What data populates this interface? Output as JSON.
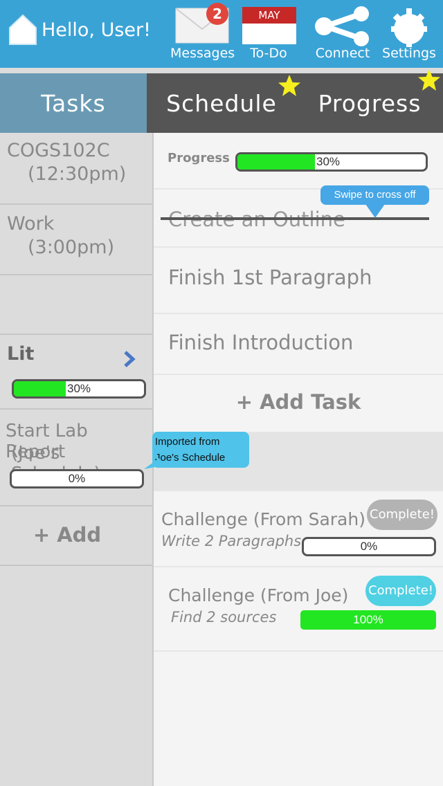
{
  "header": {
    "greeting": "Hello, User!",
    "messages": {
      "label": "Messages",
      "badge": "2"
    },
    "todo": {
      "label": "To-Do",
      "month": "MAY"
    },
    "connect": {
      "label": "Connect"
    },
    "settings": {
      "label": "Settings"
    }
  },
  "tabs": [
    {
      "label": "Tasks"
    },
    {
      "label": "Schedule"
    },
    {
      "label": "Progress"
    }
  ],
  "sidebar": {
    "items": [
      {
        "title": "COGS102C",
        "time": "(12:30pm)"
      },
      {
        "title": "Work",
        "time": "(3:00pm)"
      },
      {
        "title": "Lit",
        "progress_text": "30%",
        "progress": 0.3
      },
      {
        "title": "Start Lab Report",
        "subtitle": "(Joe's Schedule)",
        "progress_text": "0%",
        "progress": 0
      }
    ],
    "add_label": "+ Add"
  },
  "main": {
    "progress_label": "Progress",
    "progress_text": "30%",
    "progress": 0.3,
    "tasks": [
      {
        "label": "Create an Outline",
        "crossed": true
      },
      {
        "label": "Finish 1st Paragraph"
      },
      {
        "label": "Finish Introduction"
      }
    ],
    "add_task_label": "+ Add Task",
    "swipe_hint": "Swipe to cross off",
    "imported_hint_line1": "Imported from",
    "imported_hint_line2": "Joe's Schedule",
    "challenges": [
      {
        "title": "Challenge (From Sarah)",
        "subtitle": "Write 2 Paragraphs",
        "button": "Complete!",
        "progress_text": "0%",
        "progress": 0,
        "button_color": "#b3b3b3"
      },
      {
        "title": "Challenge (From Joe)",
        "subtitle": "Find 2 sources",
        "button": "Complete!",
        "progress_text": "100%",
        "progress": 1,
        "button_color": "#4fd0e3"
      }
    ]
  },
  "colors": {
    "header": "#3aa3d6",
    "progress_fill": "#22e622",
    "active_tab": "#6a9ab3",
    "bubble": "#4fc3ea"
  }
}
